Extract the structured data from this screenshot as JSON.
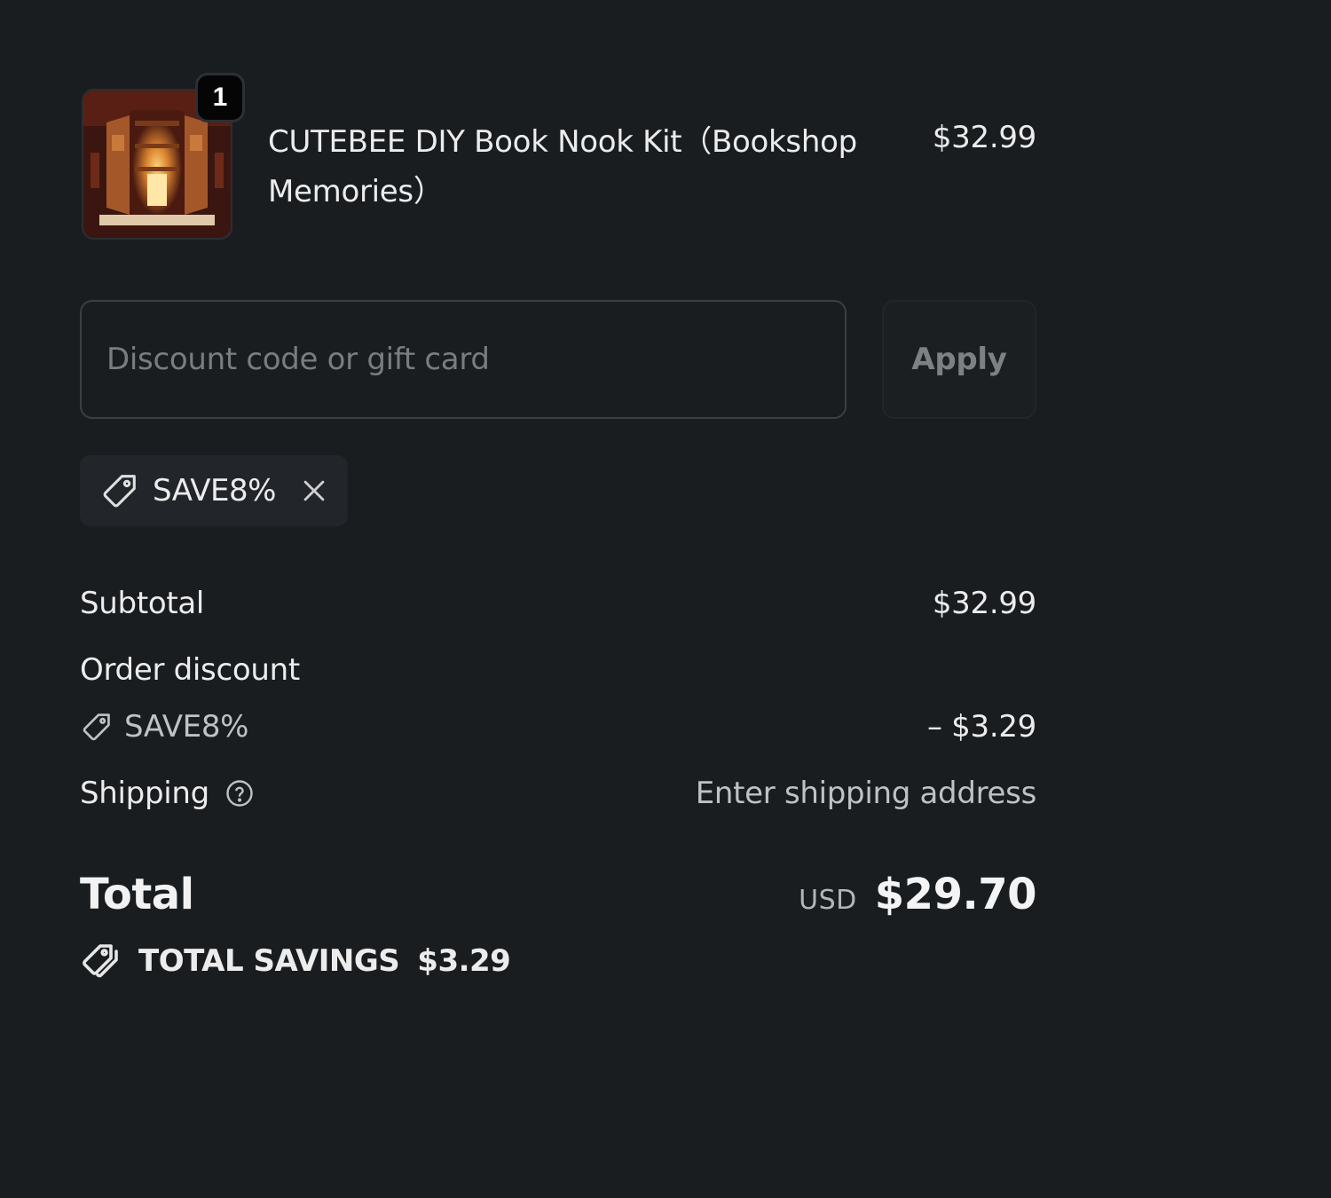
{
  "product": {
    "quantity": "1",
    "name": "CUTEBEE DIY Book Nook Kit（Bookshop Memories）",
    "price": "$32.99",
    "image_icon": "book-nook-image"
  },
  "discount": {
    "placeholder": "Discount code or gift card",
    "value": "",
    "apply_label": "Apply",
    "applied_code": "SAVE8%"
  },
  "summary": {
    "subtotal_label": "Subtotal",
    "subtotal_value": "$32.99",
    "order_discount_label": "Order discount",
    "discount_code": "SAVE8%",
    "discount_value": "– $3.29",
    "shipping_label": "Shipping",
    "shipping_value": "Enter shipping address",
    "total_label": "Total",
    "currency": "USD",
    "total_value": "$29.70",
    "savings_label": "TOTAL SAVINGS",
    "savings_value": "$3.29"
  },
  "colors": {
    "background": "#1a1d20",
    "text": "#ececec",
    "muted_text": "#bfc2c5",
    "input_border": "#3b3f43",
    "chip_background": "#22262a",
    "badge_background": "#050505"
  }
}
